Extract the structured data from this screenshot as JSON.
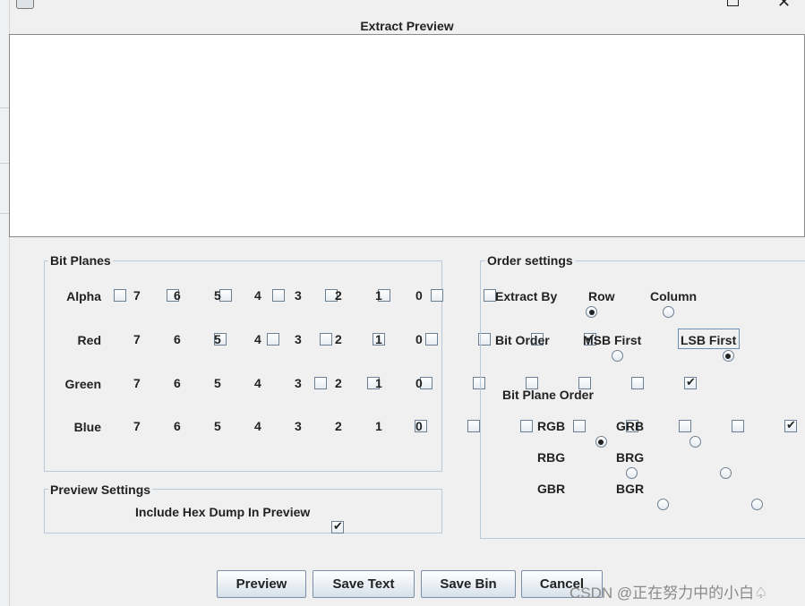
{
  "window": {
    "title": "Extract Preview"
  },
  "bit_planes": {
    "legend": "Bit Planes",
    "rows": [
      {
        "label": "Alpha",
        "bits": [
          {
            "num": "7",
            "checked": false
          },
          {
            "num": "6",
            "checked": false
          },
          {
            "num": "5",
            "checked": false
          },
          {
            "num": "4",
            "checked": false
          },
          {
            "num": "3",
            "checked": false
          },
          {
            "num": "2",
            "checked": false
          },
          {
            "num": "1",
            "checked": false
          },
          {
            "num": "0",
            "checked": false
          }
        ]
      },
      {
        "label": "Red",
        "bits": [
          {
            "num": "7",
            "checked": false
          },
          {
            "num": "6",
            "checked": false
          },
          {
            "num": "5",
            "checked": false
          },
          {
            "num": "4",
            "checked": false
          },
          {
            "num": "3",
            "checked": false
          },
          {
            "num": "2",
            "checked": false
          },
          {
            "num": "1",
            "checked": false
          },
          {
            "num": "0",
            "checked": true
          }
        ]
      },
      {
        "label": "Green",
        "bits": [
          {
            "num": "7",
            "checked": false
          },
          {
            "num": "6",
            "checked": false
          },
          {
            "num": "5",
            "checked": false
          },
          {
            "num": "4",
            "checked": false
          },
          {
            "num": "3",
            "checked": false
          },
          {
            "num": "2",
            "checked": false
          },
          {
            "num": "1",
            "checked": false
          },
          {
            "num": "0",
            "checked": true
          }
        ]
      },
      {
        "label": "Blue",
        "bits": [
          {
            "num": "7",
            "checked": false
          },
          {
            "num": "6",
            "checked": false
          },
          {
            "num": "5",
            "checked": false
          },
          {
            "num": "4",
            "checked": false
          },
          {
            "num": "3",
            "checked": false
          },
          {
            "num": "2",
            "checked": false
          },
          {
            "num": "1",
            "checked": false
          },
          {
            "num": "0",
            "checked": true
          }
        ]
      }
    ]
  },
  "preview_settings": {
    "legend": "Preview Settings",
    "hex_dump_label": "Include Hex Dump In Preview",
    "hex_dump_checked": true
  },
  "order_settings": {
    "legend": "Order settings",
    "extract_by": {
      "label": "Extract By",
      "options": [
        "Row",
        "Column"
      ],
      "selected": "Row"
    },
    "bit_order": {
      "label": "Bit Order",
      "options": [
        "MSB First",
        "LSB First"
      ],
      "selected": "LSB First"
    },
    "bit_plane_order": {
      "label": "Bit Plane Order",
      "options": [
        "RGB",
        "GRB",
        "RBG",
        "BRG",
        "GBR",
        "BGR"
      ],
      "selected": "RGB"
    }
  },
  "buttons": {
    "preview": "Preview",
    "save_text": "Save Text",
    "save_bin": "Save Bin",
    "cancel": "Cancel"
  },
  "watermark": "CSDN @正在努力中的小白♤"
}
